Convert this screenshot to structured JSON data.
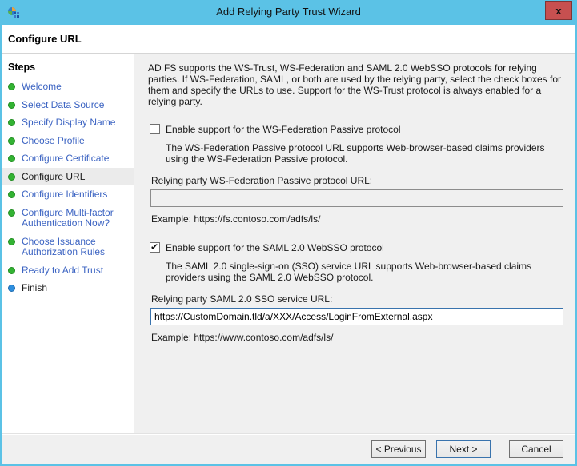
{
  "window": {
    "title": "Add Relying Party Trust Wizard",
    "close_glyph": "x"
  },
  "header": {
    "title": "Configure URL"
  },
  "sidebar": {
    "heading": "Steps",
    "items": [
      {
        "label": "Welcome",
        "state": "done"
      },
      {
        "label": "Select Data Source",
        "state": "done"
      },
      {
        "label": "Specify Display Name",
        "state": "done"
      },
      {
        "label": "Choose Profile",
        "state": "done"
      },
      {
        "label": "Configure Certificate",
        "state": "done"
      },
      {
        "label": "Configure URL",
        "state": "current"
      },
      {
        "label": "Configure Identifiers",
        "state": "done"
      },
      {
        "label": "Configure Multi-factor Authentication Now?",
        "state": "done"
      },
      {
        "label": "Choose Issuance Authorization Rules",
        "state": "done"
      },
      {
        "label": "Ready to Add Trust",
        "state": "done"
      },
      {
        "label": "Finish",
        "state": "finish"
      }
    ]
  },
  "content": {
    "intro": "AD FS supports the WS-Trust, WS-Federation and SAML 2.0 WebSSO protocols for relying parties.  If WS-Federation, SAML, or both are used by the relying party, select the check boxes for them and specify the URLs to use.  Support for the WS-Trust protocol is always enabled for a relying party.",
    "wsfed": {
      "checkbox_label": "Enable support for the WS-Federation Passive protocol",
      "checked": false,
      "description": "The WS-Federation Passive protocol URL supports Web-browser-based claims providers using the WS-Federation Passive protocol.",
      "url_label": "Relying party WS-Federation Passive protocol URL:",
      "url_value": "",
      "example": "Example: https://fs.contoso.com/adfs/ls/"
    },
    "saml": {
      "checkbox_label": "Enable support for the SAML 2.0 WebSSO protocol",
      "checked": true,
      "description": "The SAML 2.0 single-sign-on (SSO) service URL supports Web-browser-based claims providers using the SAML 2.0 WebSSO protocol.",
      "url_label": "Relying party SAML 2.0 SSO service URL:",
      "url_value": "https://CustomDomain.tld/a/XXX/Access/LoginFromExternal.aspx",
      "example": "Example: https://www.contoso.com/adfs/ls/"
    }
  },
  "footer": {
    "previous_label": "< Previous",
    "next_label": "Next >",
    "cancel_label": "Cancel"
  },
  "colors": {
    "titlebar": "#5BC2E6",
    "close_button": "#C75050",
    "step_link": "#3B63C2",
    "step_bullet_done": "#33B333",
    "step_bullet_finish": "#2E8FDF",
    "current_step_highlight": "#EBEBEB",
    "focused_input_border": "#3973AD"
  }
}
